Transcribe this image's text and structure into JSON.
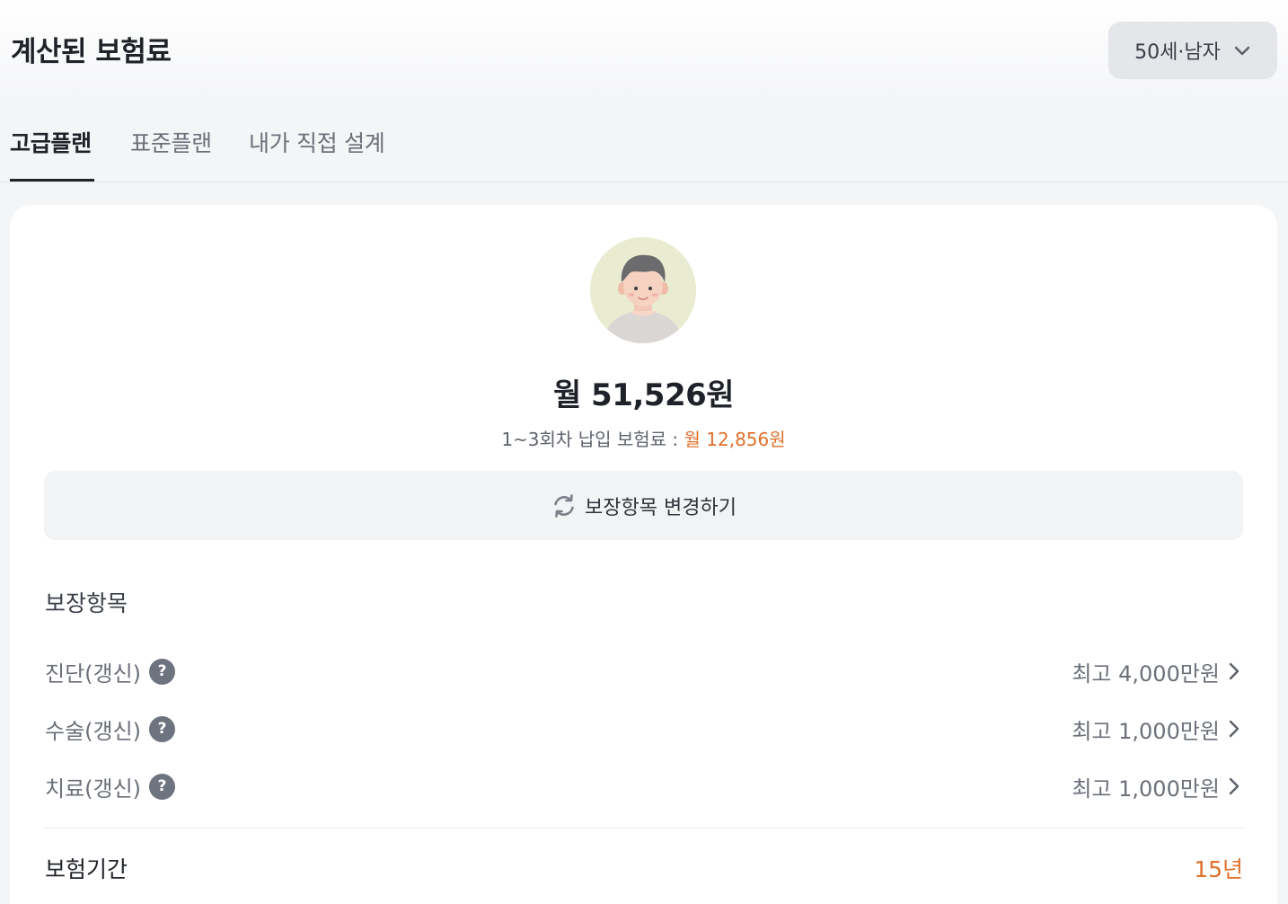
{
  "header": {
    "title": "계산된 보험료",
    "age_gender_select": "50세·남자"
  },
  "tabs": [
    {
      "label": "고급플랜",
      "active": true
    },
    {
      "label": "표준플랜",
      "active": false
    },
    {
      "label": "내가 직접 설계",
      "active": false
    }
  ],
  "summary": {
    "monthly_premium": "월 51,526원",
    "early_label": "1~3회차 납입 보험료 : ",
    "early_value": "월 12,856원"
  },
  "change_button": {
    "label": "보장항목 변경하기",
    "icon": "refresh-icon"
  },
  "coverage": {
    "section_title": "보장항목",
    "items": [
      {
        "label": "진단(갱신)",
        "help": "?",
        "value": "최고 4,000만원"
      },
      {
        "label": "수술(갱신)",
        "help": "?",
        "value": "최고 1,000만원"
      },
      {
        "label": "치료(갱신)",
        "help": "?",
        "value": "최고 1,000만원"
      }
    ]
  },
  "period": {
    "label": "보험기간",
    "value": "15년"
  },
  "colors": {
    "accent": "#e0702a",
    "text_primary": "#1f2329",
    "text_secondary": "#6b7079",
    "background": "#f4f5f7"
  }
}
